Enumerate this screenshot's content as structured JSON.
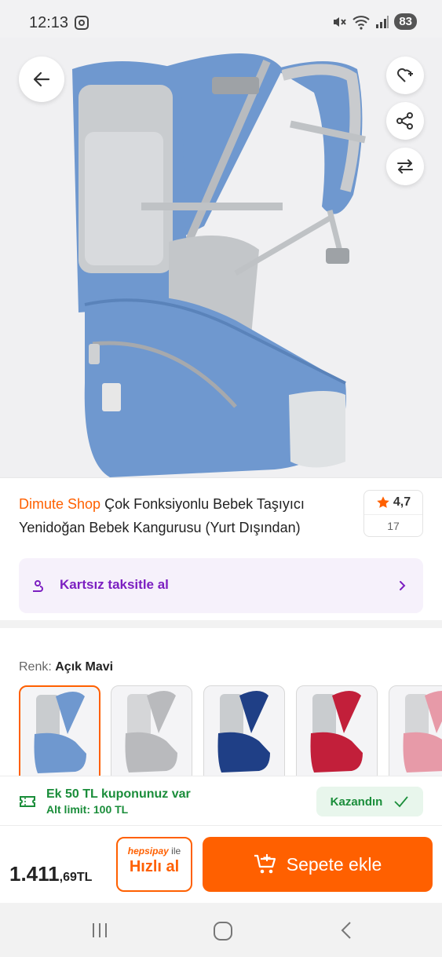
{
  "status_bar": {
    "time": "12:13",
    "battery": "83",
    "icons": [
      "instagram-icon",
      "mute-icon",
      "wifi-icon",
      "signal-icon"
    ]
  },
  "hero": {
    "actions": [
      "back-arrow-icon",
      "favorite-list-icon",
      "share-icon",
      "compare-icon"
    ]
  },
  "product": {
    "shop_name": "Dimute Shop",
    "title": "Çok Fonksiyonlu Bebek Taşıyıcı Yenidoğan Bebek Kangurusu (Yurt Dışından)",
    "rating": "4,7",
    "review_count": "17"
  },
  "installment": {
    "label": "Kartsız taksitle al"
  },
  "variants": {
    "label": "Renk:",
    "selected": "Açık Mavi",
    "colors": [
      "#6f98cf",
      "#b9babd",
      "#1f3f86",
      "#c21f3a",
      "#e79aa8"
    ]
  },
  "coupon": {
    "title": "Ek 50 TL kuponunuz var",
    "subtitle": "Alt limit: 100 TL",
    "status": "Kazandın"
  },
  "buy": {
    "price_main": "1.411",
    "price_cents": ",69TL",
    "quick_brand": "hepsipay",
    "quick_suffix": "ile",
    "quick_label": "Hızlı al",
    "add_to_cart": "Sepete ekle"
  },
  "colors": {
    "accent": "#ff6000",
    "purple": "#7c1fc1",
    "green": "#1a8d3a"
  }
}
